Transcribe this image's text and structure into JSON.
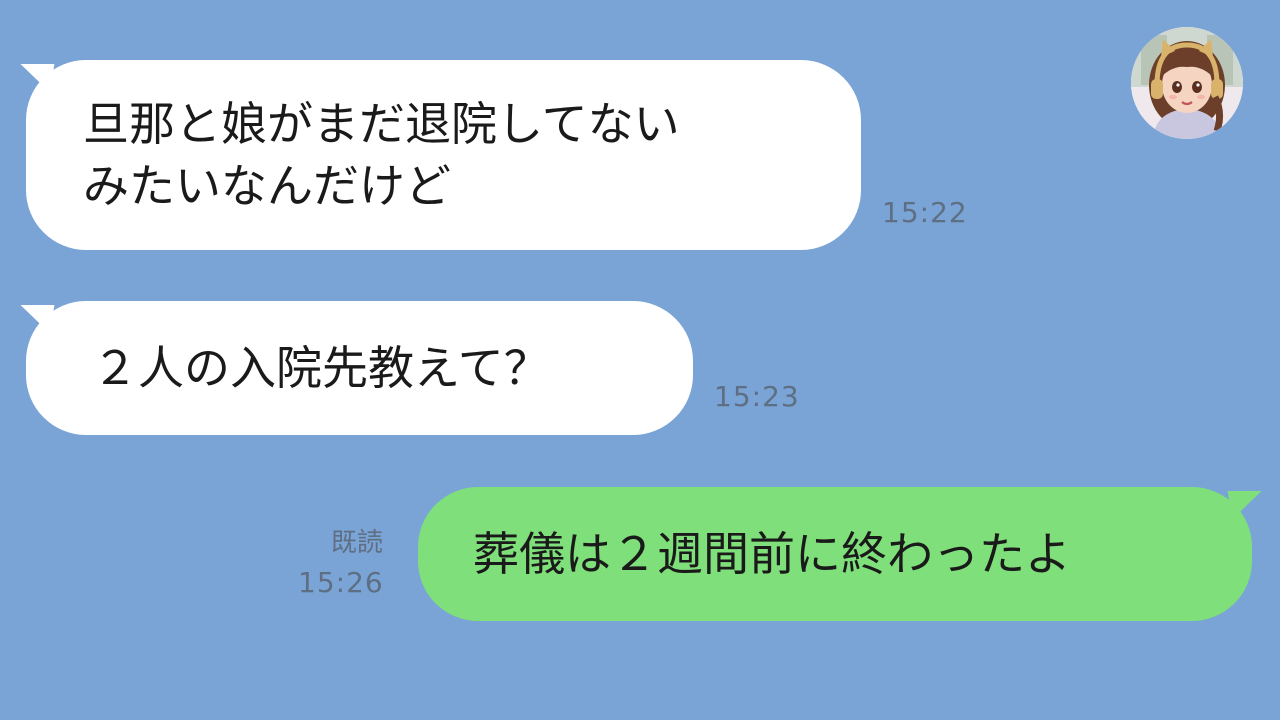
{
  "messages": [
    {
      "direction": "incoming",
      "text": "旦那と娘がまだ退院してない\nみたいなんだけど",
      "time": "15:22"
    },
    {
      "direction": "incoming",
      "text": "２人の入院先教えて？",
      "time": "15:23"
    },
    {
      "direction": "outgoing",
      "text": "葬儀は２週間前に終わったよ",
      "time": "15:26",
      "read_label": "既読"
    }
  ],
  "colors": {
    "background": "#7aa4d6",
    "incoming_bubble": "#ffffff",
    "outgoing_bubble": "#7fdf7a",
    "timestamp": "#5e6f84"
  },
  "avatar": {
    "icon": "user-avatar-illustration"
  }
}
